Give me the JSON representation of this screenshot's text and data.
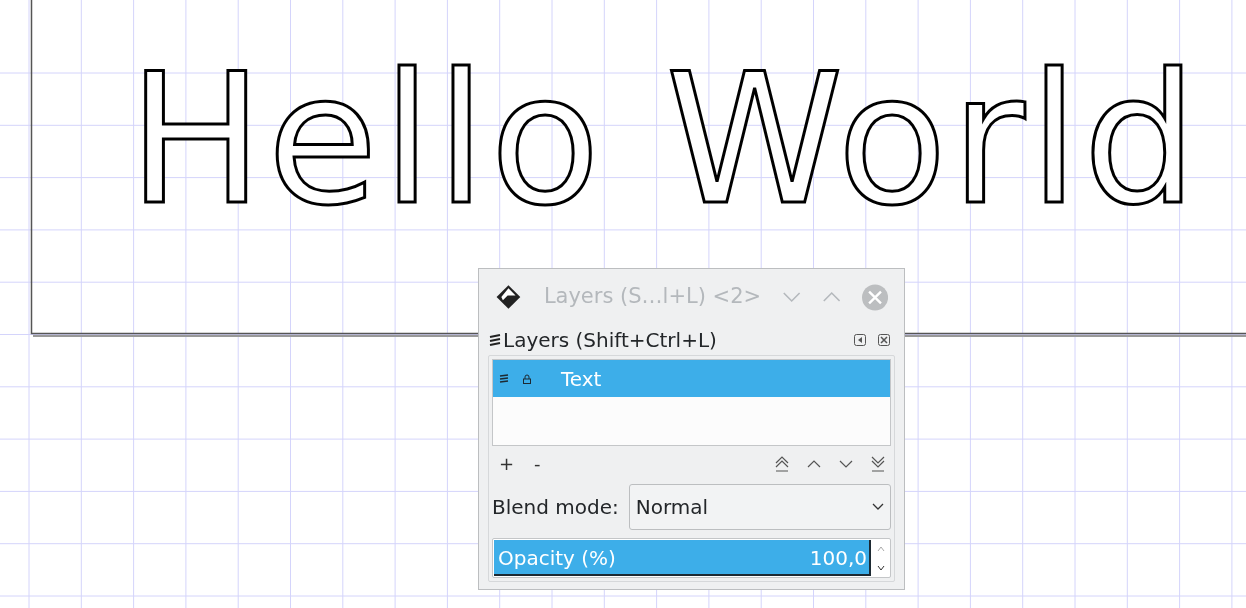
{
  "canvas": {
    "text": "Hello World"
  },
  "dialog": {
    "title": "Layers (S…l+L) <2>",
    "panel_title": "Layers (Shift+Ctrl+L)",
    "layers": [
      {
        "name": "Text",
        "selected": true
      }
    ],
    "layer_buttons": [
      "+",
      "-"
    ],
    "blend_mode": {
      "label": "Blend mode:",
      "value": "Normal"
    },
    "opacity": {
      "label": "Opacity (%)",
      "value": "100,0",
      "level": 1
    }
  }
}
